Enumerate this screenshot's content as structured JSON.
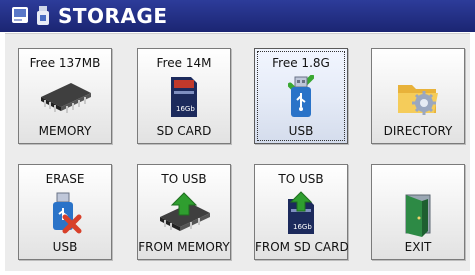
{
  "window": {
    "title": "STORAGE"
  },
  "tiles": [
    {
      "top": "Free 137MB",
      "bottom": "MEMORY",
      "icon": "memory-chip-icon"
    },
    {
      "top": "Free 14M",
      "bottom": "SD CARD",
      "icon": "sd-card-icon",
      "card_text": "16Gb",
      "card_brand": "XXXXX"
    },
    {
      "top": "Free 1.8G",
      "bottom": "USB",
      "icon": "usb-drive-icon",
      "selected": true
    },
    {
      "top": "",
      "bottom": "DIRECTORY",
      "icon": "folder-gear-icon"
    },
    {
      "top": "ERASE",
      "bottom": "USB",
      "icon": "usb-erase-icon"
    },
    {
      "top": "TO USB",
      "bottom": "FROM MEMORY",
      "icon": "memory-to-usb-icon"
    },
    {
      "top": "TO USB",
      "bottom": "FROM SD CARD",
      "icon": "sdcard-to-usb-icon",
      "card_text": "16Gb"
    },
    {
      "top": "",
      "bottom": "EXIT",
      "icon": "exit-door-icon"
    }
  ],
  "colors": {
    "titlebar": "#1f2a80",
    "selected_tile": "#e4eaf6",
    "check": "#3aa832",
    "arrow": "#2f9e2f",
    "erase_x": "#d8402a"
  }
}
